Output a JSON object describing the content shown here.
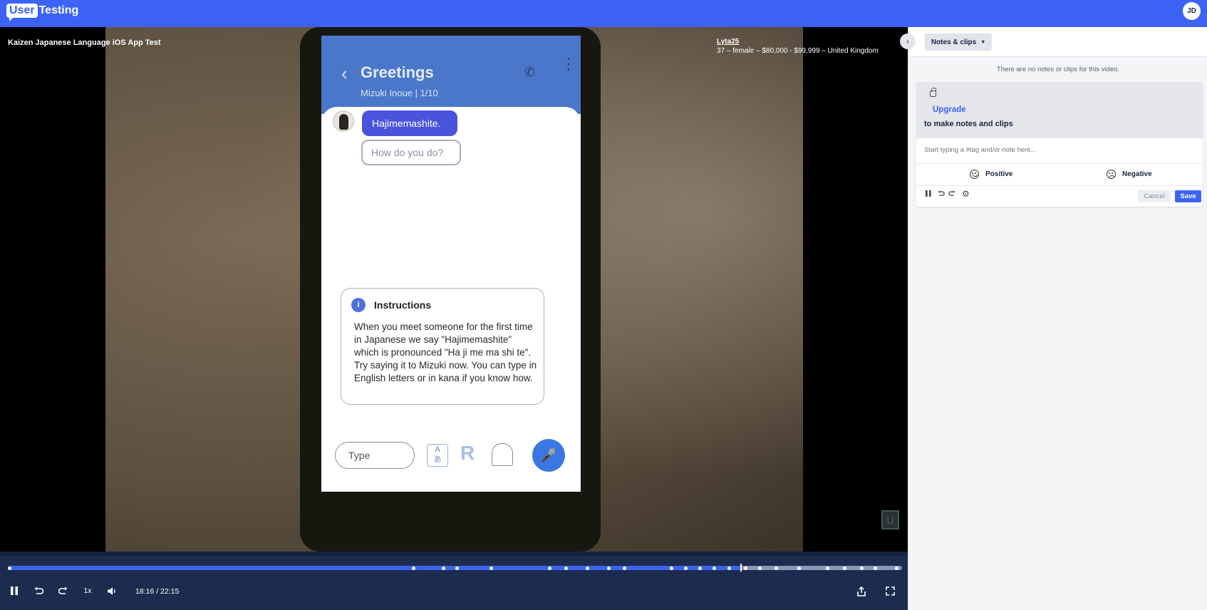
{
  "header": {
    "logo_boxed": "User",
    "logo_text": "Testing",
    "avatar_initials": "JD"
  },
  "video": {
    "title": "Kaizen Japanese Language iOS App Test",
    "participant_name": "Lyta25",
    "participant_details": "37 – female – $80,000 - $99,999 – United Kingdom"
  },
  "phone_screen": {
    "header_title": "Greetings",
    "header_sub": "Mizuki Inoue | 1/10",
    "bubble_main": "Hajimemashite.",
    "bubble_sub": "How do you do?",
    "instructions_title": "Instructions",
    "instructions_body": "When you meet someone for the first time in Japanese we say \"Hajimemashite\" which is pronounced \"Ha ji me ma shi te\". Try saying it to Mizuki now. You can type in English letters or in kana if you know how.",
    "type_placeholder": "Type"
  },
  "player": {
    "speed": "1x",
    "time": "18:16 / 22:15",
    "progress": 0.82,
    "markers": [
      0.0,
      0.454,
      0.487,
      0.502,
      0.541,
      0.606,
      0.624,
      0.648,
      0.672,
      0.69,
      0.742,
      0.758,
      0.774,
      0.79,
      0.807,
      0.825,
      0.841,
      0.859,
      0.885,
      0.917,
      0.936,
      0.955,
      0.97,
      0.994
    ]
  },
  "panel": {
    "notes_button": "Notes & clips",
    "empty_message": "There are no notes or clips for this video.",
    "upgrade_link": "Upgrade",
    "upgrade_text": "to make notes and clips",
    "note_placeholder": "Start typing a #tag and/or note here...",
    "positive_label": "Positive",
    "negative_label": "Negative",
    "cancel_label": "Cancel",
    "save_label": "Save"
  },
  "colors": {
    "brand": "#3d63f4",
    "controls_bg": "#1d2c4e"
  },
  "icons": [
    "pause-icon",
    "rewind-icon",
    "forward-icon",
    "volume-icon",
    "share-icon",
    "fullscreen-icon",
    "lock-icon",
    "smile-icon",
    "frown-icon",
    "gear-icon",
    "chevron-right-icon"
  ]
}
